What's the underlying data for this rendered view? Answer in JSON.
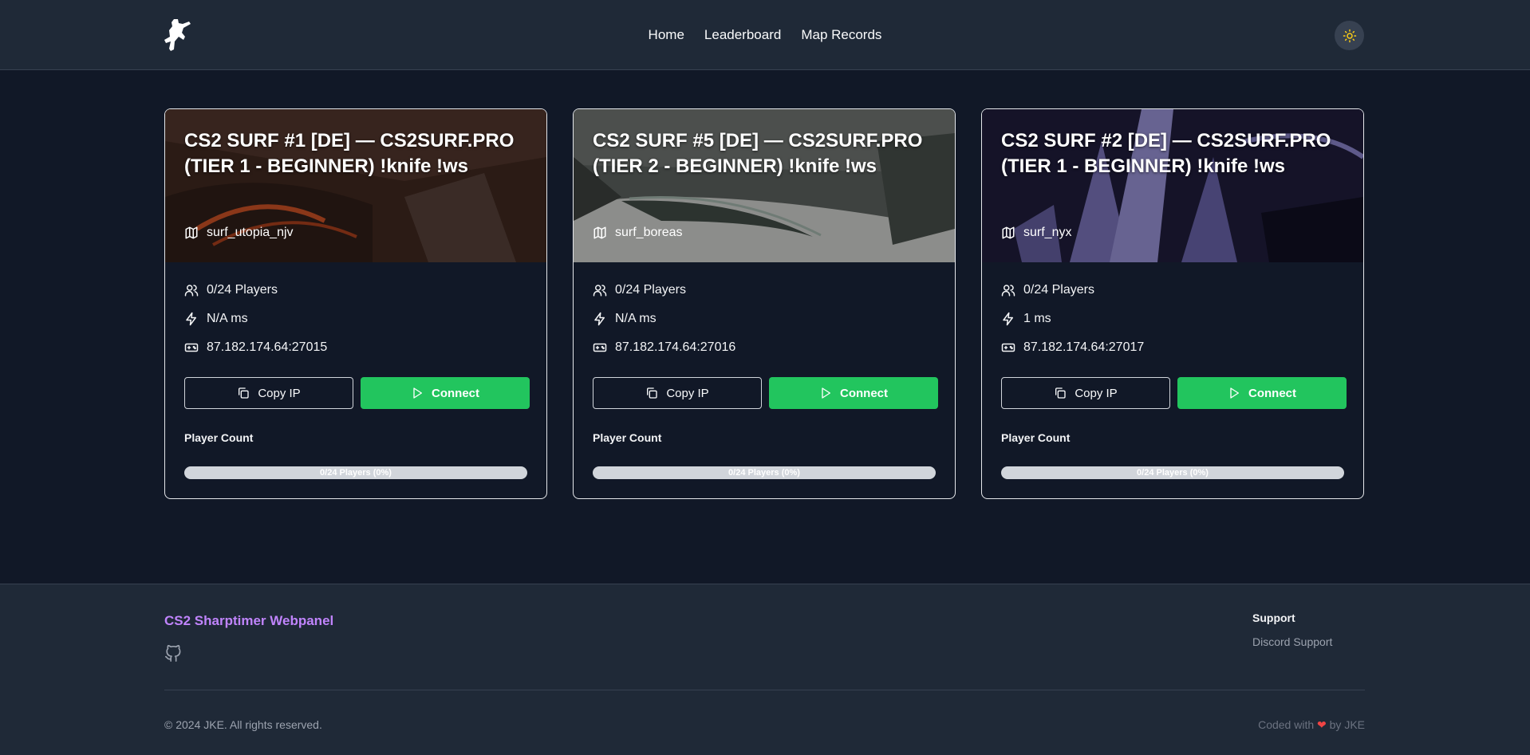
{
  "nav": {
    "items": [
      "Home",
      "Leaderboard",
      "Map Records"
    ]
  },
  "theme_toggle": {
    "icon": "sun-icon"
  },
  "servers": [
    {
      "title": "CS2 SURF #1 [DE] — CS2SURF.PRO (TIER 1 - BEGINNER) !knife !ws",
      "map": "surf_utopia_njv",
      "players": "0/24 Players",
      "ping": "N/A ms",
      "ip": "87.182.174.64:27015",
      "copy_label": "Copy IP",
      "connect_label": "Connect",
      "player_count_label": "Player Count",
      "progress_text": "0/24 Players (0%)",
      "fill_fraction": 0
    },
    {
      "title": "CS2 SURF #5 [DE] — CS2SURF.PRO (TIER 2 - BEGINNER) !knife !ws",
      "map": "surf_boreas",
      "players": "0/24 Players",
      "ping": "N/A ms",
      "ip": "87.182.174.64:27016",
      "copy_label": "Copy IP",
      "connect_label": "Connect",
      "player_count_label": "Player Count",
      "progress_text": "0/24 Players (0%)",
      "fill_fraction": 0
    },
    {
      "title": "CS2 SURF #2 [DE] — CS2SURF.PRO (TIER 1 - BEGINNER) !knife !ws",
      "map": "surf_nyx",
      "players": "0/24 Players",
      "ping": "1 ms",
      "ip": "87.182.174.64:27017",
      "copy_label": "Copy IP",
      "connect_label": "Connect",
      "player_count_label": "Player Count",
      "progress_text": "0/24 Players (0%)",
      "fill_fraction": 0
    }
  ],
  "footer": {
    "brand": "CS2 Sharptimer Webpanel",
    "support_title": "Support",
    "support_link": "Discord Support",
    "copyright": "© 2024 JKE. All rights reserved.",
    "coded_prefix": "Coded with",
    "coded_suffix": "by JKE"
  },
  "colors": {
    "accent_green": "#22c55e",
    "brand_purple": "#c084fc",
    "background": "#111827",
    "header_bg": "#1f2937"
  }
}
